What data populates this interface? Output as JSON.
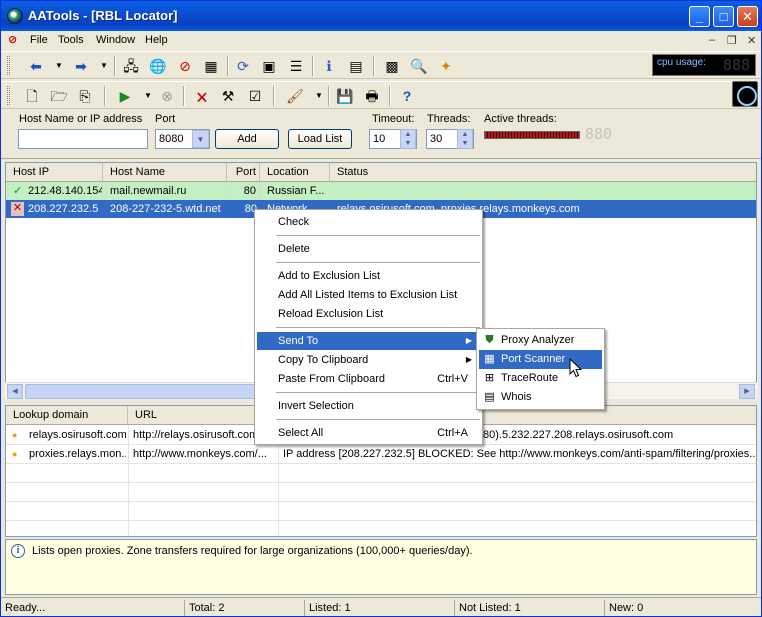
{
  "window": {
    "title": "AATools - [RBL Locator]"
  },
  "menu": {
    "items": [
      "File",
      "Tools",
      "Window",
      "Help"
    ]
  },
  "cpu": {
    "label": "cpu usage:",
    "digits": "888"
  },
  "input_panel": {
    "host_label": "Host Name or IP address",
    "host_value": "",
    "port_label": "Port",
    "port_value": "8080",
    "add_label": "Add",
    "load_list_label": "Load List",
    "timeout_label": "Timeout:",
    "timeout_value": "10",
    "threads_label": "Threads:",
    "threads_value": "30",
    "active_threads_label": "Active threads:",
    "active_digits": "880"
  },
  "hosts_table": {
    "columns": [
      "Host IP",
      "Host Name",
      "Port",
      "Location",
      "Status"
    ],
    "rows": [
      {
        "icon": "check-icon",
        "ip": "212.48.140.154",
        "name": "mail.newmail.ru",
        "port": "80",
        "location": "Russian F...",
        "status": ""
      },
      {
        "icon": "cross-icon",
        "ip": "208.227.232.5",
        "name": "208-227-232-5.wtd.net",
        "port": "80",
        "location": "Network...",
        "status": "relays.osirusoft.com, proxies.relays.monkeys.com"
      }
    ]
  },
  "lookup_table": {
    "columns": [
      "Lookup domain",
      "URL",
      ""
    ],
    "rows": [
      {
        "domain": "relays.osirusoft.com",
        "url": "http://relays.osirusoft.com...",
        "info": "80).5.232.227.208.relays.osirusoft.com"
      },
      {
        "domain": "proxies.relays.mon...",
        "url": "http://www.monkeys.com/...",
        "info": "IP address [208.227.232.5] BLOCKED: See http://www.monkeys.com/anti-spam/filtering/proxies..."
      }
    ]
  },
  "context_menu": {
    "check": "Check",
    "delete": "Delete",
    "add_exclusion": "Add to Exclusion List",
    "add_all_exclusion": "Add All Listed Items to Exclusion List",
    "reload_exclusion": "Reload Exclusion List",
    "send_to": "Send To",
    "copy_clipboard": "Copy To Clipboard",
    "paste_clipboard": "Paste From Clipboard",
    "paste_shortcut": "Ctrl+V",
    "invert": "Invert Selection",
    "select_all": "Select All",
    "select_all_shortcut": "Ctrl+A"
  },
  "submenu": {
    "proxy_analyzer": "Proxy Analyzer",
    "port_scanner": "Port Scanner",
    "traceroute": "TraceRoute",
    "whois": "Whois"
  },
  "description": "Lists open proxies. Zone transfers required for large organizations (100,000+ queries/day).",
  "status_bar": {
    "ready": "Ready...",
    "total": "Total: 2",
    "listed": "Listed: 1",
    "not_listed": "Not Listed: 1",
    "new": "New: 0"
  }
}
